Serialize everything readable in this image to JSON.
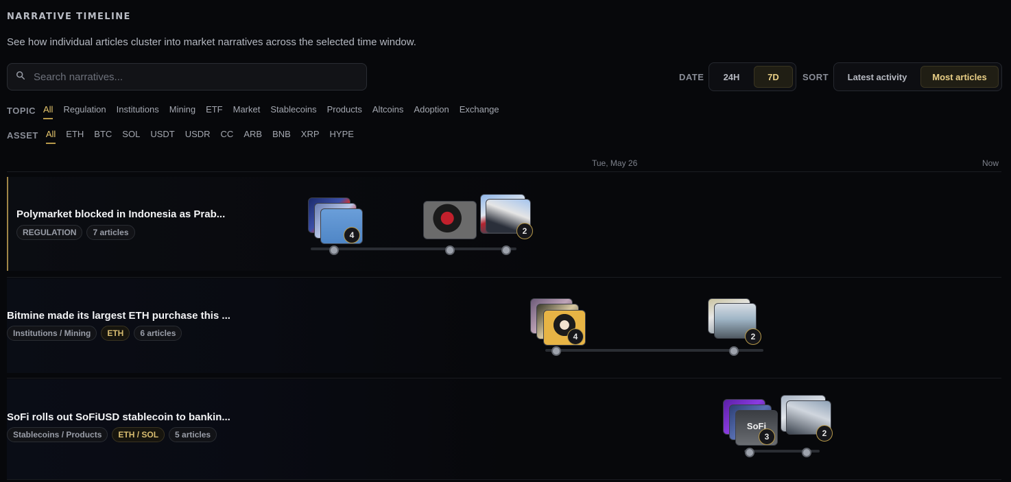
{
  "header": {
    "title": "NARRATIVE TIMELINE",
    "subtitle": "See how individual articles cluster into market narratives across the selected time window."
  },
  "search": {
    "placeholder": "Search narratives..."
  },
  "date": {
    "label": "DATE",
    "options": [
      "24H",
      "7D"
    ],
    "selected": "7D"
  },
  "sort": {
    "label": "SORT",
    "options": [
      "Latest activity",
      "Most articles"
    ],
    "selected": "Most articles"
  },
  "topic": {
    "label": "TOPIC",
    "options": [
      "All",
      "Regulation",
      "Institutions",
      "Mining",
      "ETF",
      "Market",
      "Stablecoins",
      "Products",
      "Altcoins",
      "Adoption",
      "Exchange"
    ],
    "selected": "All"
  },
  "asset": {
    "label": "ASSET",
    "options": [
      "All",
      "ETH",
      "BTC",
      "SOL",
      "USDT",
      "USDR",
      "CC",
      "ARB",
      "BNB",
      "XRP",
      "HYPE"
    ],
    "selected": "All"
  },
  "axis": {
    "mid": "Tue, May 26",
    "end": "Now"
  },
  "narratives": [
    {
      "title": "Polymarket blocked in Indonesia as Prab...",
      "tags": [
        "REGULATION",
        "7 articles"
      ],
      "clusters": [
        {
          "count": "4"
        },
        {
          "count": "2"
        }
      ]
    },
    {
      "title": "Bitmine made its largest ETH purchase this ...",
      "tags": [
        "Institutions / Mining",
        "ETH",
        "6 articles"
      ],
      "clusters": [
        {
          "count": "4"
        },
        {
          "count": "2"
        }
      ]
    },
    {
      "title": "SoFi rolls out SoFiUSD stablecoin to bankin...",
      "tags": [
        "Stablecoins / Products",
        "ETH / SOL",
        "5 articles"
      ],
      "clusters": [
        {
          "count": "3"
        },
        {
          "count": "2"
        }
      ],
      "thumb_text": "SoFi"
    }
  ],
  "colors": {
    "accent": "#e8c86e",
    "background": "#07080b"
  }
}
